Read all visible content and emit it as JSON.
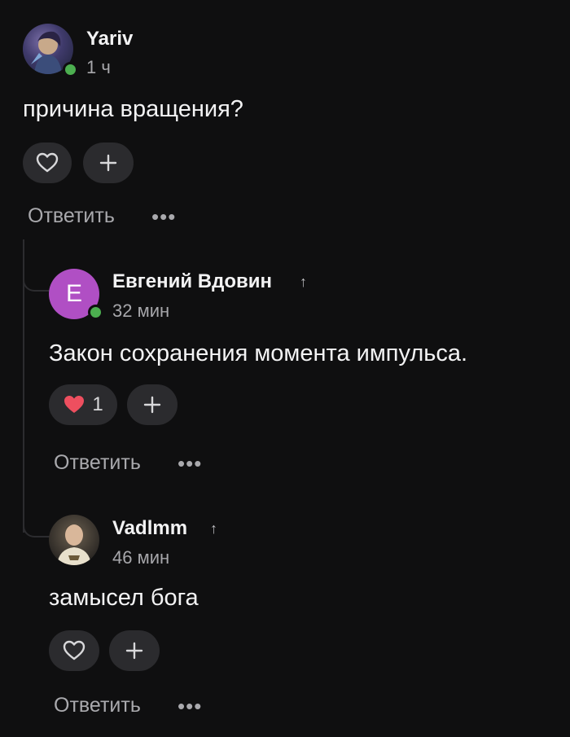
{
  "comments": [
    {
      "username": "Yariv",
      "time": "1 ч",
      "text": "причина вращения?",
      "avatar_icon": "character-avatar",
      "online": true,
      "likes": "",
      "reply_label": "Ответить",
      "more_label": "•••"
    },
    {
      "username": "Евгений Вдовин",
      "time": "32 мин",
      "text": "Закон сохранения момента импульса.",
      "avatar_letter": "E",
      "avatar_color": "#b04fc4",
      "online": true,
      "likes": "1",
      "reply_label": "Ответить",
      "more_label": "•••",
      "upvote_icon": "↑"
    },
    {
      "username": "Vadlmm",
      "time": "46 мин",
      "text": "замысел бога",
      "avatar_icon": "photo-avatar",
      "online": false,
      "likes": "",
      "reply_label": "Ответить",
      "more_label": "•••",
      "upvote_icon": "↑"
    }
  ],
  "colors": {
    "background": "#0f0f10",
    "pill": "#2b2b2e",
    "heart_active": "#ee4f5f",
    "online": "#4caf50"
  }
}
